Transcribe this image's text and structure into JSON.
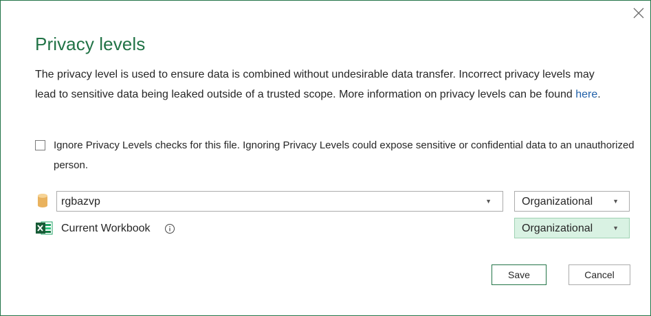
{
  "dialog": {
    "title": "Privacy levels",
    "description": "The privacy level is used to ensure data is combined without undesirable data transfer. Incorrect privacy levels may lead to sensitive data being leaked outside of a trusted scope. More information on privacy levels can be found ",
    "link_text": "here",
    "description_end": ".",
    "ignore_checkbox": {
      "checked": false,
      "label": "Ignore Privacy Levels checks for this file. Ignoring Privacy Levels could expose sensitive or confidential data to an unauthorized person."
    },
    "sources": [
      {
        "icon": "database-icon",
        "name": "rgbazvp",
        "level": "Organizational"
      },
      {
        "icon": "excel-icon",
        "name": "Current Workbook",
        "level": "Organizational"
      }
    ],
    "buttons": {
      "save": "Save",
      "cancel": "Cancel"
    },
    "colors": {
      "accent": "#217346",
      "link": "#1f5fa8",
      "highlight": "#d9f2e3"
    }
  }
}
